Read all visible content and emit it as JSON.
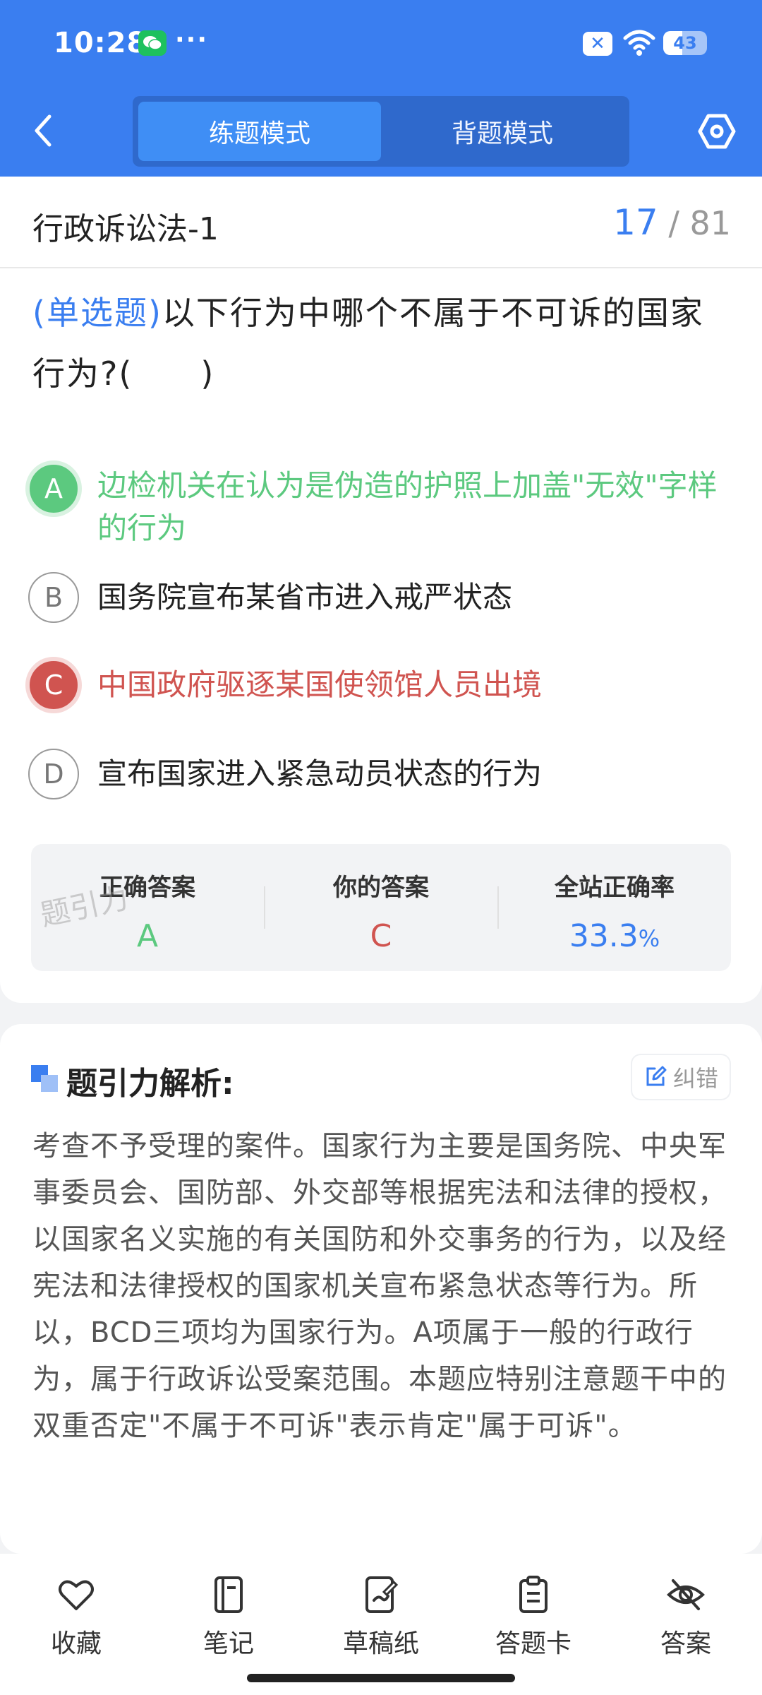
{
  "status_bar": {
    "time": "10:28",
    "more": "···",
    "battery": "43",
    "battery_level": 0.43
  },
  "header": {
    "tabs": [
      {
        "label": "练题模式",
        "active": true
      },
      {
        "label": "背题模式",
        "active": false
      }
    ],
    "accent_color": "#3a7ef0"
  },
  "section": {
    "title": "行政诉讼法-1",
    "current": "17",
    "total": "/ 81"
  },
  "question": {
    "type_tag": "(单选题)",
    "text": "以下行为中哪个不属于不可诉的国家行为?(　　)"
  },
  "options": [
    {
      "letter": "A",
      "text": "边检机关在认为是伪造的护照上加盖\"无效\"字样的行为",
      "state": "correct"
    },
    {
      "letter": "B",
      "text": "国务院宣布某省市进入戒严状态",
      "state": "normal"
    },
    {
      "letter": "C",
      "text": "中国政府驱逐某国使领馆人员出境",
      "state": "wrong"
    },
    {
      "letter": "D",
      "text": "宣布国家进入紧急动员状态的行为",
      "state": "normal"
    }
  ],
  "stats": {
    "correct_label": "正确答案",
    "correct_value": "A",
    "yours_label": "你的答案",
    "yours_value": "C",
    "rate_label": "全站正确率",
    "rate_value": "33.3",
    "rate_unit": "%",
    "watermark": "题引力"
  },
  "analysis": {
    "title": "题引力解析:",
    "report_label": "纠错",
    "body": "考查不予受理的案件。国家行为主要是国务院、中央军事委员会、国防部、外交部等根据宪法和法律的授权，以国家名义实施的有关国防和外交事务的行为，以及经宪法和法律授权的国家机关宣布紧急状态等行为。所以，BCD三项均为国家行为。A项属于一般的行政行为，属于行政诉讼受案范围。本题应特别注意题干中的双重否定\"不属于不可诉\"表示肯定\"属于可诉\"。"
  },
  "bottom_bar": {
    "items": [
      {
        "label": "收藏",
        "icon": "heart-icon"
      },
      {
        "label": "笔记",
        "icon": "notebook-icon"
      },
      {
        "label": "草稿纸",
        "icon": "draft-icon"
      },
      {
        "label": "答题卡",
        "icon": "clipboard-icon"
      },
      {
        "label": "答案",
        "icon": "eye-off-icon"
      }
    ]
  }
}
